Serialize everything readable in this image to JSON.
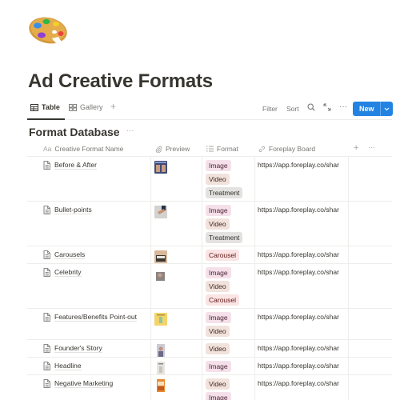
{
  "page": {
    "icon": "artist-palette-icon",
    "title": "Ad Creative Formats"
  },
  "views": {
    "tabs": [
      {
        "label": "Table",
        "icon": "table-icon",
        "active": true
      },
      {
        "label": "Gallery",
        "icon": "gallery-icon",
        "active": false
      }
    ],
    "add_label": "+"
  },
  "toolbar": {
    "filter_label": "Filter",
    "sort_label": "Sort",
    "search_icon": "search-icon",
    "expand_icon": "expand-icon",
    "more_label": "···",
    "new_label": "New",
    "accent_color": "#2383e2"
  },
  "database": {
    "title": "Format Database",
    "more_label": "···",
    "columns": [
      {
        "label": "Creative Format Name",
        "icon": "Aa"
      },
      {
        "label": "Preview",
        "icon": "paperclip-icon"
      },
      {
        "label": "Format",
        "icon": "list-icon"
      },
      {
        "label": "Foreplay Board",
        "icon": "link-icon"
      }
    ],
    "add_column_label": "+",
    "rows": [
      {
        "name": "Before & After",
        "preview": "before-after-thumbnail",
        "formats": [
          "Image",
          "Video",
          "Treatment"
        ],
        "board": "https://app.foreplay.co/shar"
      },
      {
        "name": "Bullet-points",
        "preview": "bullet-points-thumbnail",
        "formats": [
          "Image",
          "Video",
          "Treatment"
        ],
        "board": "https://app.foreplay.co/shar"
      },
      {
        "name": "Carousels",
        "preview": "carousels-thumbnail",
        "formats": [
          "Carousel"
        ],
        "board": "https://app.foreplay.co/shar"
      },
      {
        "name": "Celebrity",
        "preview": "celebrity-thumbnail",
        "formats": [
          "Image",
          "Video",
          "Carousel"
        ],
        "board": "https://app.foreplay.co/shar"
      },
      {
        "name": "Features/Benefits Point-out",
        "preview": "features-thumbnail",
        "formats": [
          "Image",
          "Video"
        ],
        "board": "https://app.foreplay.co/shar"
      },
      {
        "name": "Founder's Story",
        "preview": "founder-thumbnail",
        "formats": [
          "Video"
        ],
        "board": "https://app.foreplay.co/shar"
      },
      {
        "name": "Headline",
        "preview": "headline-thumbnail",
        "formats": [
          "Image"
        ],
        "board": "https://app.foreplay.co/shar"
      },
      {
        "name": "Negative Marketing",
        "preview": "negative-marketing-thumbnail",
        "formats": [
          "Video",
          "Image"
        ],
        "board": "https://app.foreplay.co/shar"
      }
    ]
  }
}
